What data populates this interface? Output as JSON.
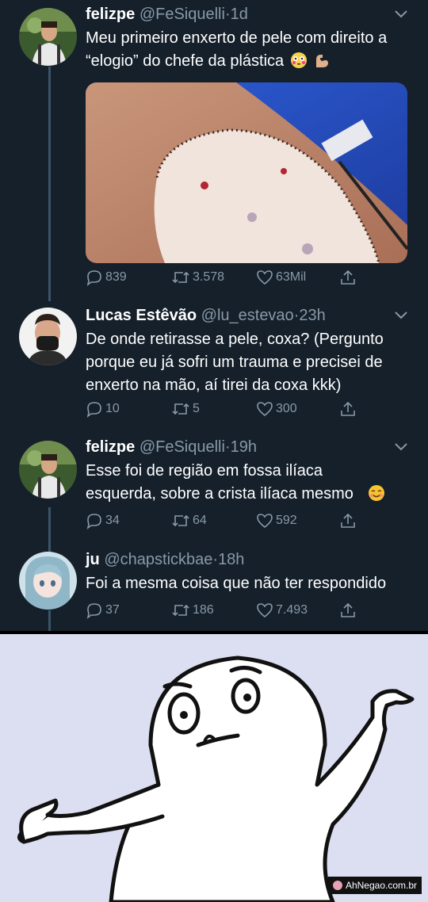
{
  "thread": {
    "tweets": [
      {
        "name": "felizpe",
        "handle": "@FeSiquelli",
        "dot": "·",
        "age": "1d",
        "text_lines": [
          "Meu primeiro enxerto de pele com direito a",
          "“elogio” do chefe da plástica"
        ],
        "emoji": [
          "flushed-face-emoji",
          "flexed-biceps-emoji"
        ],
        "has_media": true,
        "replies": "839",
        "retweets": "3.578",
        "likes": "63Mil"
      },
      {
        "name": "Lucas Estêvão",
        "handle": "@lu_estevao",
        "dot": "·",
        "age": "23h",
        "text_lines": [
          "De onde retirasse a pele, coxa? (Pergunto",
          "porque eu já sofri um trauma e precisei de",
          "enxerto na mão, aí tirei da coxa kkk)"
        ],
        "replies": "10",
        "retweets": "5",
        "likes": "300"
      },
      {
        "name": "felizpe",
        "handle": "@FeSiquelli",
        "dot": "·",
        "age": "19h",
        "text_lines": [
          "Esse foi de região em fossa ilíaca",
          "esquerda, sobre a crista ilíaca mesmo"
        ],
        "emoji": [
          "smiling-face-emoji"
        ],
        "replies": "34",
        "retweets": "64",
        "likes": "592"
      },
      {
        "name": "ju",
        "handle": "@chapstickbae",
        "dot": "·",
        "age": "18h",
        "text_lines": [
          "Foi a mesma coisa que não ter respondido"
        ],
        "replies": "37",
        "retweets": "186",
        "likes": "7.493"
      }
    ]
  },
  "meme": {
    "description_icon": "shrugging-rage-face",
    "watermark": "AhNegao.com.br"
  },
  "colors": {
    "background": "#15202b",
    "text": "#ffffff",
    "muted": "#8899a6",
    "thread_line": "#3d5466",
    "meme_bg": "#dcdff2"
  }
}
